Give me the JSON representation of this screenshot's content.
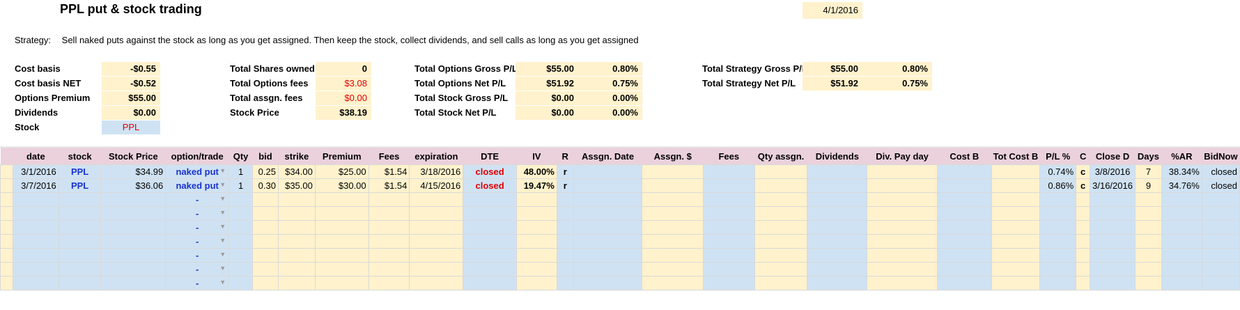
{
  "title": "PPL put & stock trading",
  "date": "4/1/2016",
  "strategy": {
    "label": "Strategy:",
    "text": "Sell naked puts against the stock as long as you get assigned. Then keep the stock, collect dividends, and sell calls as long as you get assigned"
  },
  "summary": {
    "col1": [
      {
        "label": "Cost basis",
        "value": "-$0.55"
      },
      {
        "label": "Cost basis NET",
        "value": "-$0.52"
      },
      {
        "label": "Options Premium",
        "value": "$55.00"
      },
      {
        "label": "Dividends",
        "value": "$0.00"
      },
      {
        "label": "Stock",
        "value": "PPL"
      }
    ],
    "col2": [
      {
        "label": "Total Shares owned",
        "value": "0"
      },
      {
        "label": "Total Options fees",
        "value": "$3.08"
      },
      {
        "label": "Total assgn. fees",
        "value": "$0.00"
      },
      {
        "label": "Stock Price",
        "value": "$38.19"
      }
    ],
    "col3": [
      {
        "label": "Total Options Gross P/L",
        "value": "$55.00",
        "pct": "0.80%"
      },
      {
        "label": "Total Options Net P/L",
        "value": "$51.92",
        "pct": "0.75%"
      },
      {
        "label": "Total Stock Gross P/L",
        "value": "$0.00",
        "pct": "0.00%"
      },
      {
        "label": "Total Stock Net P/L",
        "value": "$0.00",
        "pct": "0.00%"
      }
    ],
    "col4": [
      {
        "label": "Total Strategy Gross P/L",
        "value": "$55.00",
        "pct": "0.80%"
      },
      {
        "label": "Total Strategy Net P/L",
        "value": "$51.92",
        "pct": "0.75%"
      }
    ]
  },
  "table": {
    "headers": [
      "date",
      "stock",
      "Stock Price",
      "option/trade",
      "Qty",
      "bid",
      "strike",
      "Premium",
      "Fees",
      "expiration",
      "DTE",
      "IV",
      "R",
      "Assgn. Date",
      "Assgn. $",
      "Fees",
      "Qty assgn.",
      "Dividends",
      "Div. Pay day",
      "Cost B",
      "Tot Cost B",
      "P/L %",
      "C",
      "Close D",
      "Days",
      "%AR",
      "BidNow"
    ],
    "rows": [
      [
        "3/1/2016",
        "PPL",
        "$34.99",
        "naked put",
        "1",
        "0.25",
        "$34.00",
        "$25.00",
        "$1.54",
        "3/18/2016",
        "closed",
        "48.00%",
        "r",
        "",
        "",
        "",
        "",
        "",
        "",
        "",
        "",
        "0.74%",
        "c",
        "3/8/2016",
        "7",
        "38.34%",
        "closed"
      ],
      [
        "3/7/2016",
        "PPL",
        "$36.06",
        "naked put",
        "1",
        "0.30",
        "$35.00",
        "$30.00",
        "$1.54",
        "4/15/2016",
        "closed",
        "19.47%",
        "r",
        "",
        "",
        "",
        "",
        "",
        "",
        "",
        "",
        "0.86%",
        "c",
        "3/16/2016",
        "9",
        "34.76%",
        "closed"
      ]
    ],
    "empty_option_placeholder": "-",
    "dropdown_icon": "dropdown-arrow-icon"
  }
}
